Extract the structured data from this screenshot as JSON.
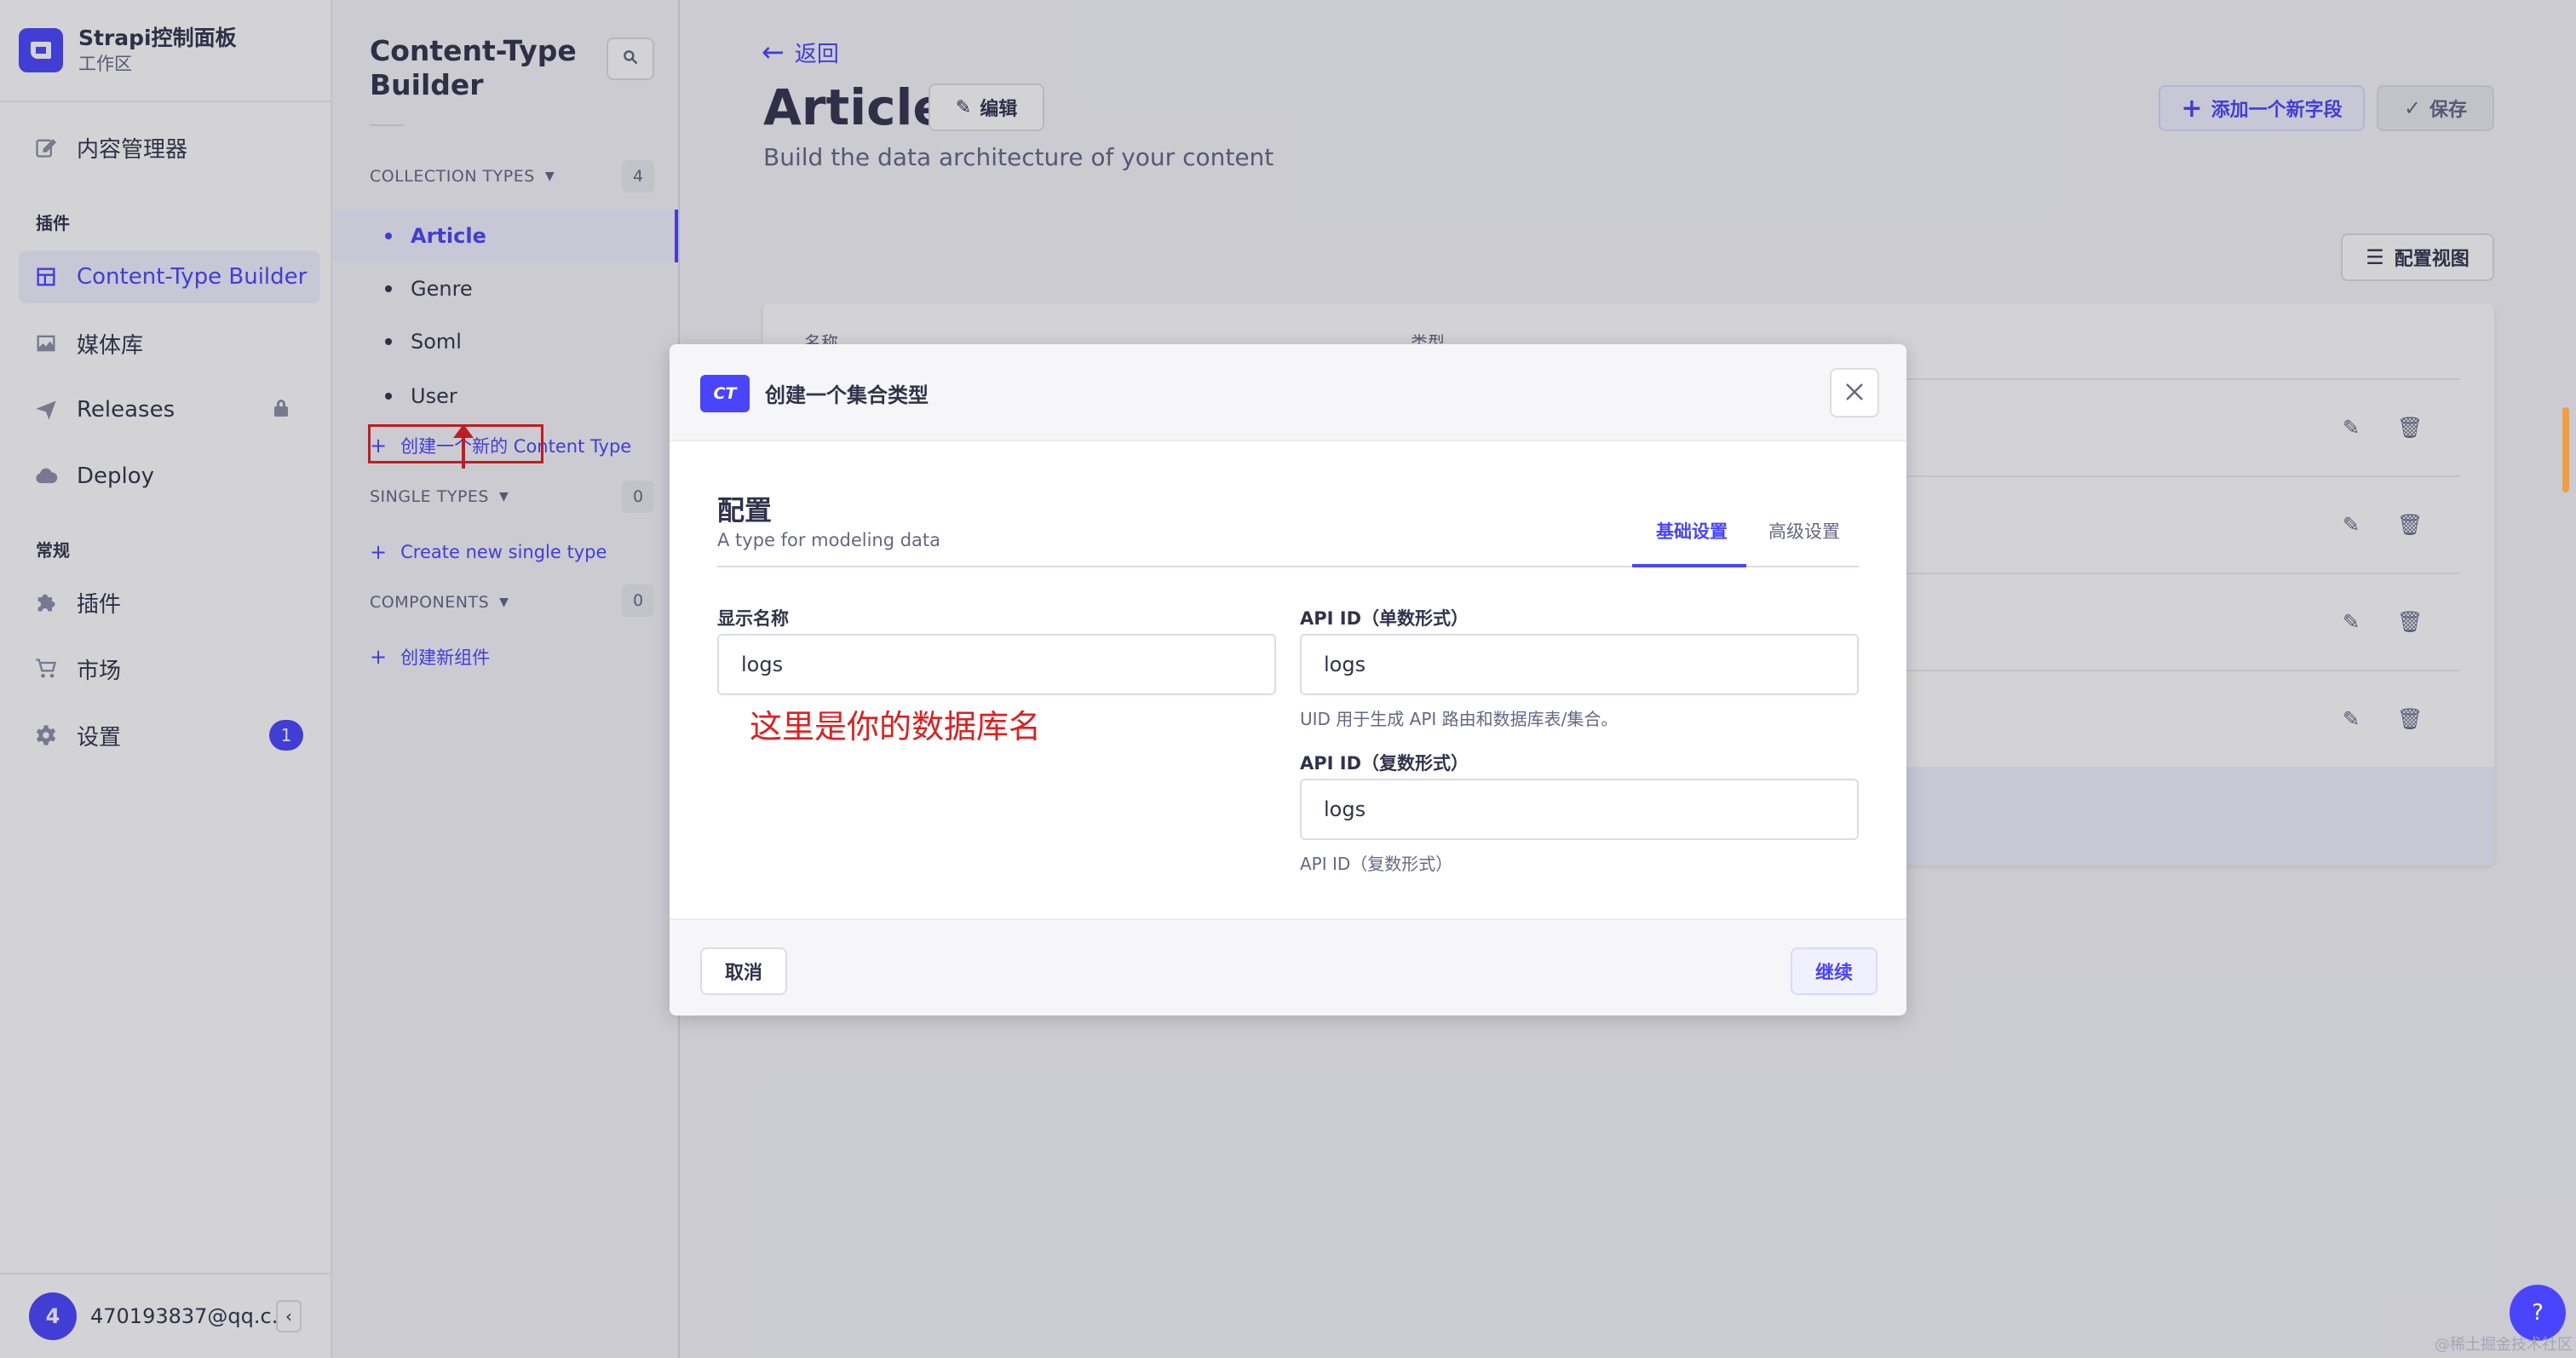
{
  "brand": {
    "title": "Strapi控制面板",
    "subtitle": "工作区"
  },
  "nav": {
    "content_manager": "内容管理器",
    "plugins_section": "插件",
    "ctb": "Content-Type Builder",
    "media": "媒体库",
    "releases": "Releases",
    "deploy": "Deploy",
    "general_section": "常规",
    "plugins": "插件",
    "market": "市场",
    "settings": "设置",
    "settings_badge": "1"
  },
  "user": {
    "initial": "4",
    "email": "470193837@qq.c..."
  },
  "subnav": {
    "title": "Content-Type Builder",
    "collection_types": {
      "label": "COLLECTION TYPES",
      "count": "4",
      "items": [
        "Article",
        "Genre",
        "Soml",
        "User"
      ],
      "add": "创建一个新的 Content Type"
    },
    "single_types": {
      "label": "SINGLE TYPES",
      "count": "0",
      "add": "Create new single type"
    },
    "components": {
      "label": "COMPONENTS",
      "count": "0",
      "add": "创建新组件"
    }
  },
  "main": {
    "back": "返回",
    "title": "Article",
    "edit": "编辑",
    "subtitle": "Build the data architecture of your content",
    "add_field": "添加一个新字段",
    "save": "保存",
    "config_view": "配置视图",
    "table_headers": [
      "名称",
      "类型"
    ]
  },
  "modal": {
    "badge": "CT",
    "title": "创建一个集合类型",
    "section_title": "配置",
    "section_sub": "A type for modeling data",
    "tabs": [
      "基础设置",
      "高级设置"
    ],
    "display_name": {
      "label": "显示名称",
      "value": "logs"
    },
    "api_singular": {
      "label": "API ID（单数形式）",
      "value": "logs",
      "hint": "UID 用于生成 API 路由和数据库表/集合。"
    },
    "api_plural": {
      "label": "API ID（复数形式）",
      "value": "logs",
      "hint": "API ID（复数形式）"
    },
    "annotation": "这里是你的数据库名",
    "cancel": "取消",
    "continue": "继续"
  },
  "help": "?",
  "watermark": "@稀土掘金技术社区",
  "colors": {
    "primary": "#4945ff",
    "annotation": "#e02020",
    "neutral": "#32324d"
  }
}
